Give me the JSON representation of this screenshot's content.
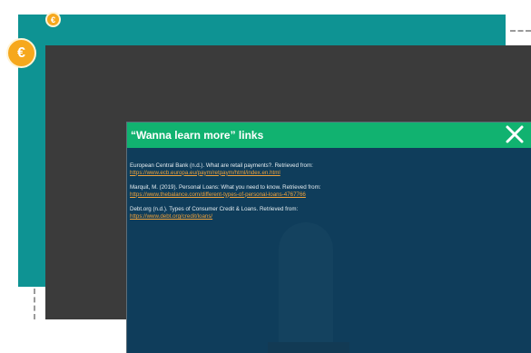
{
  "modal": {
    "title": "“Wanna learn more” links",
    "references": [
      {
        "text": "European Central Bank (n.d.). What are retail payments?. Retrieved from:",
        "link": "https://www.ecb.europa.eu/paym/retpaym/html/index.en.html"
      },
      {
        "text": "Marquit, M. (2019). Personal Loans: What you need to know. Retrieved from:",
        "link": "https://www.thebalance.com/different-types-of-personal-loans-4767766"
      },
      {
        "text": "Debt.org (n.d.). Types of Consumer Credit & Loans. Retrieved from:",
        "link": "https://www.debt.org/credit/loans/"
      }
    ]
  },
  "coins": {
    "symbol": "€"
  },
  "colors": {
    "teal": "#0e9393",
    "frame": "#3b3b3b",
    "modal_bg": "#0f3d5b",
    "header_green": "#11b270",
    "link_orange": "#f0a23a",
    "coin_gold": "#f6a81d"
  }
}
